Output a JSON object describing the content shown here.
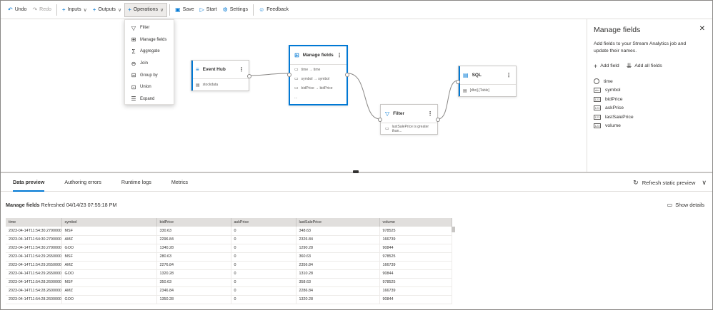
{
  "toolbar": {
    "undo": "Undo",
    "redo": "Redo",
    "inputs": "Inputs",
    "outputs": "Outputs",
    "operations": "Operations",
    "save": "Save",
    "start": "Start",
    "settings": "Settings",
    "feedback": "Feedback"
  },
  "operations_menu": [
    "Filter",
    "Manage fields",
    "Aggregate",
    "Join",
    "Group by",
    "Union",
    "Expand"
  ],
  "nodes": {
    "event_hub": {
      "title": "Event Hub",
      "row": "stockdata"
    },
    "manage_fields": {
      "title": "Manage fields",
      "rows": [
        "time → time",
        "symbol → symbol",
        "bidPrice → bidPrice",
        "..."
      ]
    },
    "filter": {
      "title": "Filter",
      "row": "lastSalePrice is greater than..."
    },
    "sql": {
      "title": "SQL",
      "row": "[dbo].[Table]"
    }
  },
  "panel": {
    "title": "Manage fields",
    "description": "Add fields to your Stream Analytics job and update their names.",
    "add_field": "Add field",
    "add_all": "Add all fields",
    "fields": [
      "time",
      "symbol",
      "bidPrice",
      "askPrice",
      "lastSalePrice",
      "volume"
    ]
  },
  "bottom": {
    "tabs": [
      "Data preview",
      "Authoring errors",
      "Runtime logs",
      "Metrics"
    ],
    "refresh": "Refresh static preview",
    "preview_title": "Manage fields",
    "preview_refreshed": "Refreshed 04/14/23 07:55:18 PM",
    "show_details": "Show details"
  },
  "table": {
    "columns": [
      "time",
      "symbol",
      "bidPrice",
      "askPrice",
      "lastSalePrice",
      "volume"
    ],
    "rows": [
      [
        "2023-04-14T11:54:30.2790000Z",
        "MSF",
        "330.63",
        "0",
        "348.63",
        "978525"
      ],
      [
        "2023-04-14T11:54:30.2790000Z",
        "AMZ",
        "2296.84",
        "0",
        "2326.84",
        "166739"
      ],
      [
        "2023-04-14T11:54:30.2790000Z",
        "GOO",
        "1340.28",
        "0",
        "1290.28",
        "90844"
      ],
      [
        "2023-04-14T11:54:29.2650000Z",
        "MSF",
        "280.63",
        "0",
        "360.63",
        "978525"
      ],
      [
        "2023-04-14T11:54:29.2650000Z",
        "AMZ",
        "2276.84",
        "0",
        "2356.84",
        "166739"
      ],
      [
        "2023-04-14T11:54:29.2650000Z",
        "GOO",
        "1320.28",
        "0",
        "1310.28",
        "90844"
      ],
      [
        "2023-04-14T11:54:28.2600000Z",
        "MSF",
        "350.63",
        "0",
        "358.63",
        "978525"
      ],
      [
        "2023-04-14T11:54:28.2600000Z",
        "AMZ",
        "2346.84",
        "0",
        "2286.84",
        "166739"
      ],
      [
        "2023-04-14T11:54:28.2600000Z",
        "GOO",
        "1350.28",
        "0",
        "1320.28",
        "90844"
      ]
    ]
  },
  "colors": {
    "accent": "#0078d4"
  }
}
